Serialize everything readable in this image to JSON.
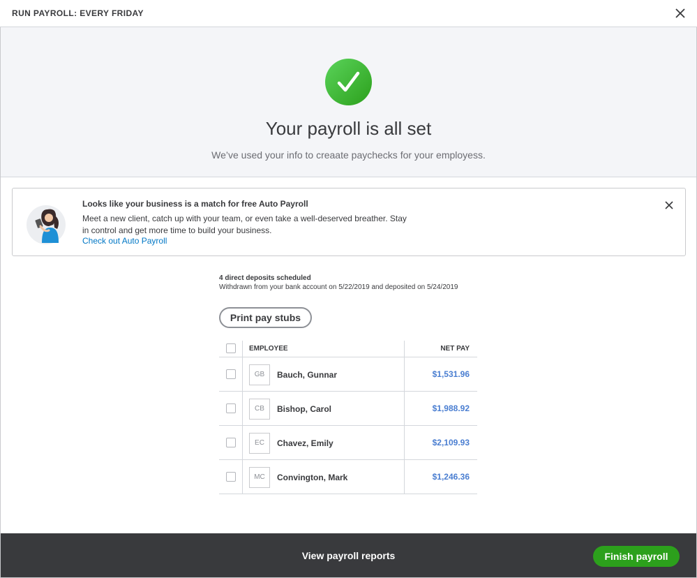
{
  "window": {
    "title": "RUN PAYROLL: EVERY FRIDAY",
    "close_icon": "close-icon"
  },
  "hero": {
    "icon": "checkmark-icon",
    "heading": "Your payroll is all set",
    "subtext": "We’ve used your info to creaate paychecks for your employess."
  },
  "promo": {
    "heading": "Looks like your business is a match for free Auto Payroll",
    "body": "Meet a new client, catch up with your team, or even take a well-deserved breather. Stay in control and get more time to build your business.",
    "link": "Check out Auto Payroll",
    "close_icon": "close-icon"
  },
  "deposits": {
    "count": "4 direct deposits scheduled",
    "detail": "Withdrawn from your bank account on 5/22/2019 and deposited on 5/24/2019"
  },
  "print_button": "Print pay stubs",
  "table": {
    "headers": {
      "employee": "EMPLOYEE",
      "net_pay": "NET PAY"
    },
    "rows": [
      {
        "initials": "GB",
        "name": "Bauch, Gunnar",
        "net_pay": "$1,531.96"
      },
      {
        "initials": "CB",
        "name": "Bishop, Carol",
        "net_pay": "$1,988.92"
      },
      {
        "initials": "EC",
        "name": "Chavez, Emily",
        "net_pay": "$2,109.93"
      },
      {
        "initials": "MC",
        "name": "Convington, Mark",
        "net_pay": "$1,246.36"
      }
    ]
  },
  "footer": {
    "reports_link": "View payroll reports",
    "finish_button": "Finish payroll"
  },
  "colors": {
    "accent_green": "#2ca01c",
    "link_blue": "#0077c5",
    "amount_blue": "#4a7ed1",
    "footer_bg": "#393a3d"
  }
}
